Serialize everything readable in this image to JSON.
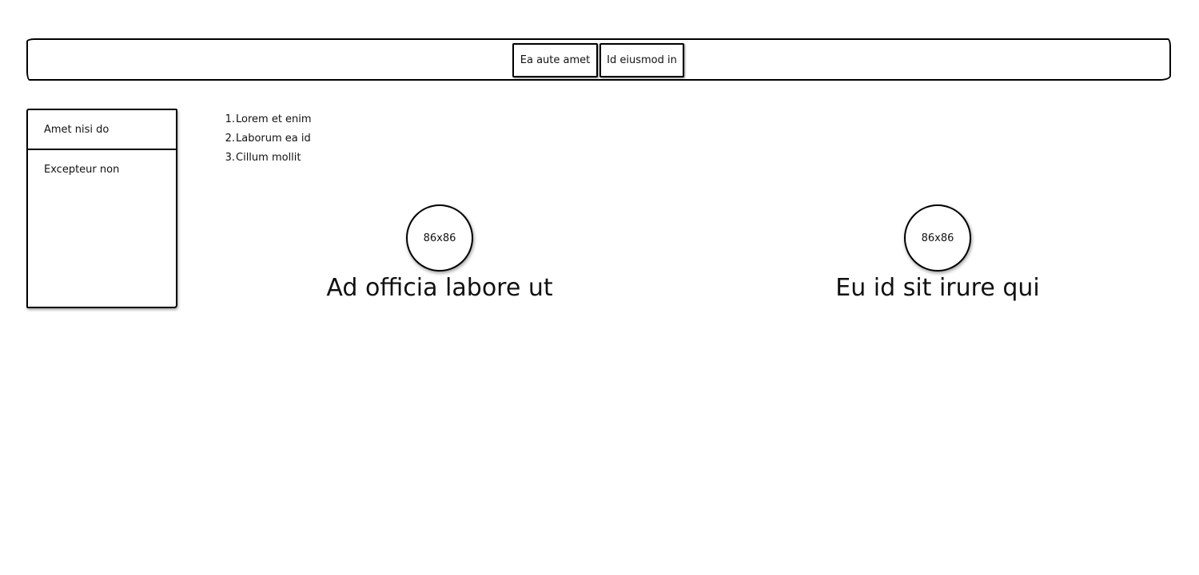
{
  "topbar": {
    "tabs": [
      {
        "label": "Ea aute amet"
      },
      {
        "label": "Id eiusmod in"
      }
    ]
  },
  "sidebar": {
    "items": [
      {
        "label": "Amet nisi do"
      },
      {
        "label": "Excepteur non"
      }
    ]
  },
  "list": {
    "items": [
      {
        "num": "1.",
        "text": "Lorem et enim"
      },
      {
        "num": "2.",
        "text": "Laborum ea id"
      },
      {
        "num": "3.",
        "text": "Cillum mollit"
      }
    ]
  },
  "cards": [
    {
      "image_label": "86x86",
      "title": "Ad officia labore ut"
    },
    {
      "image_label": "86x86",
      "title": "Eu id sit irure qui"
    }
  ]
}
